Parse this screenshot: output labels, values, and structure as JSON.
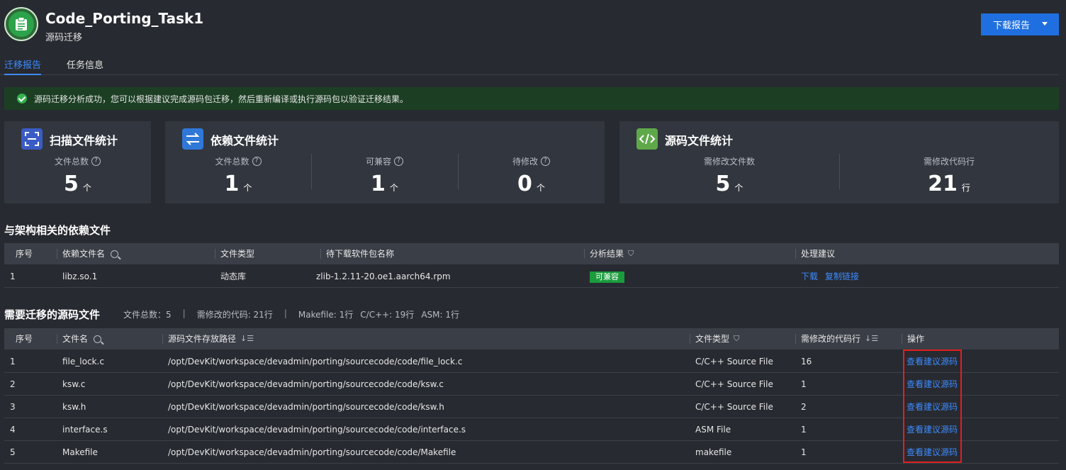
{
  "header": {
    "title": "Code_Porting_Task1",
    "subtitle": "源码迁移",
    "download_label": "下载报告"
  },
  "tabs": [
    {
      "label": "迁移报告",
      "active": true
    },
    {
      "label": "任务信息",
      "active": false
    }
  ],
  "banner": {
    "text": "源码迁移分析成功，您可以根据建议完成源码包迁移，然后重新编译或执行源码包以验证迁移结果。"
  },
  "cards": {
    "scan": {
      "title": "扫描文件统计",
      "icon": "scan-icon",
      "stats": [
        {
          "label": "文件总数",
          "value": "5",
          "unit": "个"
        }
      ]
    },
    "dependency": {
      "title": "依赖文件统计",
      "icon": "transfer-icon",
      "stats": [
        {
          "label": "文件总数",
          "value": "1",
          "unit": "个"
        },
        {
          "label": "可兼容",
          "value": "1",
          "unit": "个"
        },
        {
          "label": "待修改",
          "value": "0",
          "unit": "个"
        }
      ]
    },
    "source": {
      "title": "源码文件统计",
      "icon": "code-icon",
      "stats": [
        {
          "label": "需修改文件数",
          "value": "5",
          "unit": "个"
        },
        {
          "label": "需修改代码行",
          "value": "21",
          "unit": "行"
        }
      ]
    }
  },
  "dep_table": {
    "title": "与架构相关的依赖文件",
    "headers": [
      "序号",
      "依赖文件名",
      "文件类型",
      "待下载软件包名称",
      "分析结果",
      "处理建议"
    ],
    "rows": [
      {
        "index": "1",
        "name": "libz.so.1",
        "type": "动态库",
        "package": "zlib-1.2.11-20.oe1.aarch64.rpm",
        "result": "可兼容",
        "actions": [
          "下载",
          "复制链接"
        ]
      }
    ]
  },
  "src_table": {
    "title": "需要迁移的源码文件",
    "meta": {
      "total": "文件总数：5",
      "lines": "需修改的代码: 21行",
      "makefile": "Makefile: 1行",
      "cpp": "C/C++: 19行",
      "asm": "ASM: 1行"
    },
    "headers": [
      "序号",
      "文件名",
      "源码文件存放路径",
      "文件类型",
      "需修改的代码行",
      "操作"
    ],
    "action_label": "查看建议源码",
    "rows": [
      {
        "index": "1",
        "name": "file_lock.c",
        "path": "/opt/DevKit/workspace/devadmin/porting/sourcecode/code/file_lock.c",
        "type": "C/C++ Source File",
        "lines": "16"
      },
      {
        "index": "2",
        "name": "ksw.c",
        "path": "/opt/DevKit/workspace/devadmin/porting/sourcecode/code/ksw.c",
        "type": "C/C++ Source File",
        "lines": "1"
      },
      {
        "index": "3",
        "name": "ksw.h",
        "path": "/opt/DevKit/workspace/devadmin/porting/sourcecode/code/ksw.h",
        "type": "C/C++ Source File",
        "lines": "2"
      },
      {
        "index": "4",
        "name": "interface.s",
        "path": "/opt/DevKit/workspace/devadmin/porting/sourcecode/code/interface.s",
        "type": "ASM File",
        "lines": "1"
      },
      {
        "index": "5",
        "name": "Makefile",
        "path": "/opt/DevKit/workspace/devadmin/porting/sourcecode/code/Makefile",
        "type": "makefile",
        "lines": "1"
      }
    ]
  },
  "colors": {
    "background": "#272a30",
    "card": "#32363e",
    "accent": "#3d8bff",
    "primary_button": "#1f6fe0",
    "success_banner": "#1c3f24",
    "success_badge": "#1a9b3c",
    "highlight": "#e02020"
  }
}
